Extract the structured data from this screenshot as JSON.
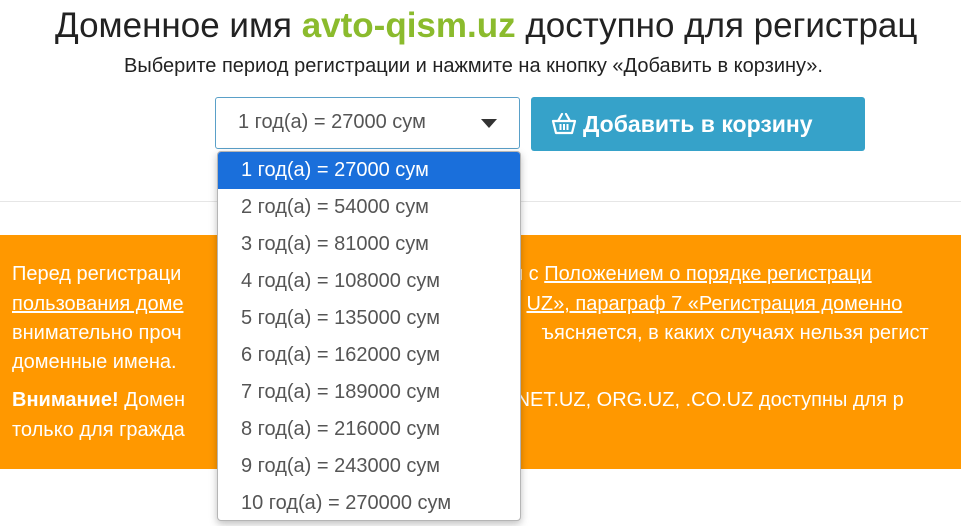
{
  "header": {
    "title_before": "Доменное имя",
    "title_domain": "avto-qism.uz",
    "title_after": "доступно для регистрац",
    "subtitle": "Выберите период регистрации и нажмите на кнопку «Добавить в корзину»."
  },
  "period_select": {
    "selected_value": "1 год(а) = 27000 сум",
    "options": [
      "1 год(а) = 27000 сум",
      "2 год(а) = 54000 сум",
      "3 год(а) = 81000 сум",
      "4 год(а) = 108000 сум",
      "5 год(а) = 135000 сум",
      "6 год(а) = 162000 сум",
      "7 год(а) = 189000 сум",
      "8 год(а) = 216000 сум",
      "9 год(а) = 243000 сум",
      "10 год(а) = 270000 сум"
    ],
    "highlighted_index": 0
  },
  "add_to_cart": {
    "icon": "basket-icon",
    "label": "Добавить в корзину"
  },
  "notice": {
    "p1_line1_a": "Перед регистраци",
    "p1_line1_b": "я с",
    "p1_line1_link": "Положением о порядке регистраци",
    "p1_line2_link_a": "пользования доме",
    "p1_line2_link_b": "UZ», параграф 7 «Регистрация доменно",
    "p1_line3_a": "внимательно проч",
    "p1_line3_b": "ъясняется, в каких случаях нельзя регист",
    "p1_line4": "доменные имена.",
    "p2_bold": "Внимание!",
    "p2_line1_a": "Домен",
    "p2_line1_b": ".NET.UZ, ORG.UZ, .CO.UZ доступны для р",
    "p2_line2": "только для гражда"
  },
  "colors": {
    "domain_green": "#8bbb2d",
    "button_blue": "#36a2c9",
    "notice_orange": "#ff9800",
    "option_highlight": "#1a6fdb"
  }
}
